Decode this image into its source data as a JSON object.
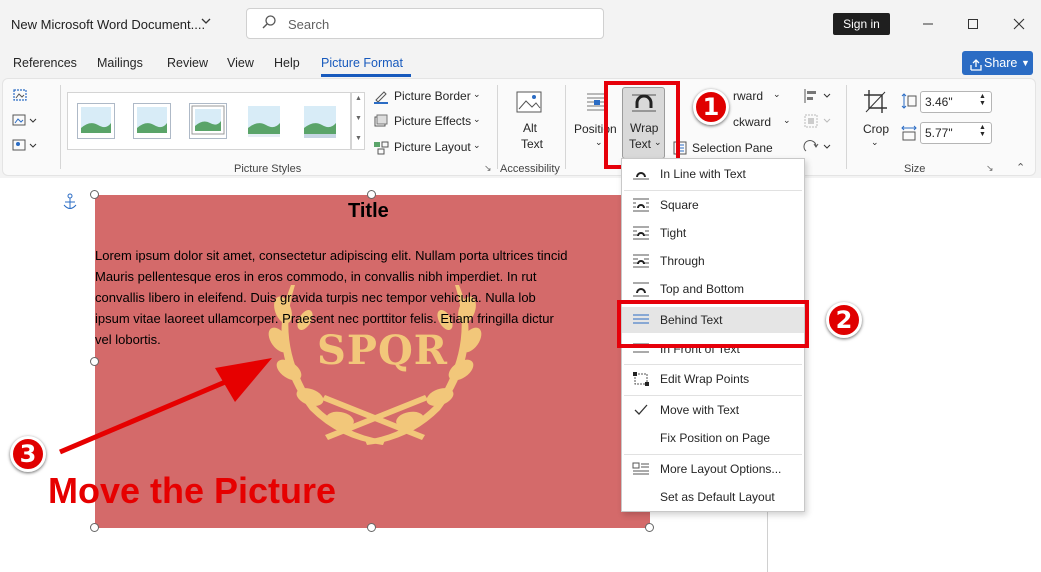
{
  "window": {
    "doc_title": "New Microsoft Word Document....",
    "search_placeholder": "Search",
    "signin_label": "Sign in"
  },
  "tabs": [
    {
      "label": "References"
    },
    {
      "label": "Mailings"
    },
    {
      "label": "Review"
    },
    {
      "label": "View"
    },
    {
      "label": "Help"
    },
    {
      "label": "Picture Format"
    }
  ],
  "share_label": "Share",
  "ribbon": {
    "picture_border": "Picture Border",
    "picture_effects": "Picture Effects",
    "picture_layout": "Picture Layout",
    "picture_styles_group": "Picture Styles",
    "alt_text_1": "Alt",
    "alt_text_2": "Text",
    "accessibility_group": "Accessibility",
    "position": "Position",
    "wrap_text_1": "Wrap",
    "wrap_text_2": "Text",
    "bring_forward_fragment": "rward",
    "send_backward_fragment": "ckward",
    "selection_pane": "Selection Pane",
    "crop": "Crop",
    "height_value": "3.46\"",
    "width_value": "5.77\"",
    "size_group": "Size"
  },
  "document": {
    "heading": "Title",
    "body_lines": [
      "Lorem ipsum dolor sit amet, consectetur adipiscing elit. Nullam porta ultrices tincid",
      "Mauris pellentesque eros in eros commodo, in convallis nibh imperdiet. In rut",
      "convallis libero in eleifend. Duis gravida turpis nec tempor vehicula. Nulla lob",
      "ipsum vitae laoreet ullamcorper. Praesent nec porttitor felis. Etiam fringilla dictur",
      "vel lobortis."
    ],
    "logo_text": "SPQR",
    "caption": "Move the Picture"
  },
  "wrap_menu": {
    "items": [
      {
        "label": "In Line with Text"
      },
      {
        "label": "Square"
      },
      {
        "label": "Tight"
      },
      {
        "label": "Through"
      },
      {
        "label": "Top and Bottom"
      },
      {
        "label": "Behind Text"
      },
      {
        "label": "In Front of Text"
      },
      {
        "label": "Edit Wrap Points"
      },
      {
        "label": "Move with Text"
      },
      {
        "label": "Fix Position on Page"
      },
      {
        "label": "More Layout Options..."
      },
      {
        "label": "Set as Default Layout"
      }
    ]
  },
  "annotations": {
    "step_1": "1",
    "step_2": "2",
    "step_3": "3"
  },
  "colors": {
    "accent": "#185abd",
    "share": "#2b6cc4",
    "annotation_red": "#e6000a",
    "picture_fill": "#d46a6a",
    "logo_gold": "#f2c77a"
  }
}
